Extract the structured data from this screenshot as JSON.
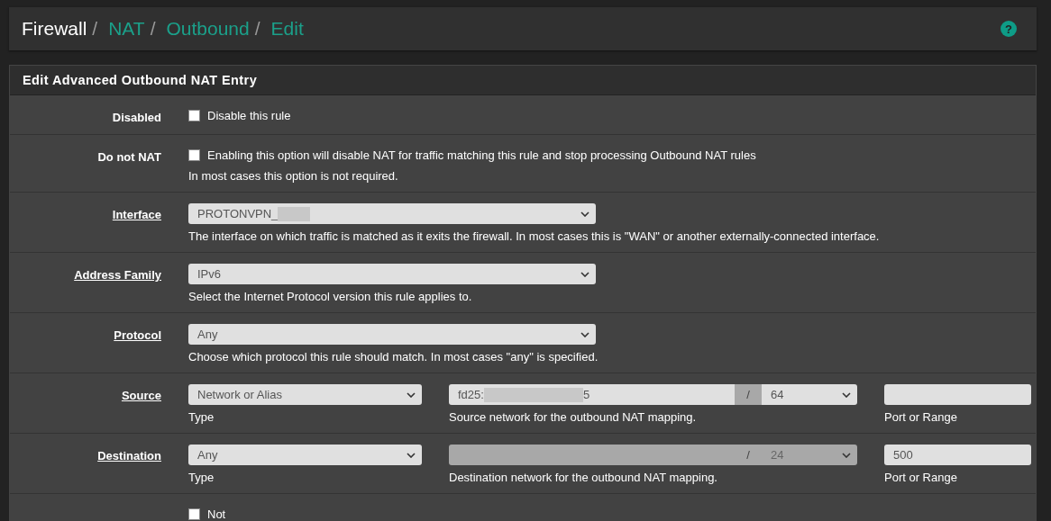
{
  "breadcrumb": [
    {
      "label": "Firewall",
      "link": false
    },
    {
      "label": "NAT",
      "link": true
    },
    {
      "label": "Outbound",
      "link": true
    },
    {
      "label": "Edit",
      "link": true
    }
  ],
  "separator": "/",
  "help": "?",
  "panel": {
    "title": "Edit Advanced Outbound NAT Entry"
  },
  "rows": [
    {
      "kind": "checkbox",
      "label": "Disabled",
      "link": false,
      "checked": false,
      "text": "Disable this rule"
    },
    {
      "kind": "checkbox",
      "label": "Do not NAT",
      "link": false,
      "checked": false,
      "text": "Enabling this option will disable NAT for traffic matching this rule and stop processing Outbound NAT rules",
      "help": "In most cases this option is not required."
    },
    {
      "kind": "select",
      "label": "Interface",
      "link": true,
      "value": "PROTONVPN_",
      "redacted": true,
      "help": "The interface on which traffic is matched as it exits the firewall. In most cases this is \"WAN\" or another externally-connected interface."
    },
    {
      "kind": "select",
      "label": "Address Family",
      "link": true,
      "value": "IPv6",
      "redacted": false,
      "help": "Select the Internet Protocol version this rule applies to."
    },
    {
      "kind": "select",
      "label": "Protocol",
      "link": true,
      "value": "Any",
      "redacted": false,
      "help": "Choose which protocol this rule should match. In most cases \"any\" is specified."
    },
    {
      "kind": "network",
      "label": "Source",
      "link": true,
      "type": "Network or Alias",
      "type_help": "Type",
      "address": {
        "start": "fd25:",
        "end": "5",
        "disabled": false
      },
      "slash": "/",
      "mask": {
        "value": "64",
        "disabled": false
      },
      "address_help": "Source network for the outbound NAT mapping.",
      "port": "",
      "port_help": "Port or Range"
    },
    {
      "kind": "network",
      "label": "Destination",
      "link": true,
      "type": "Any",
      "type_help": "Type",
      "address": {
        "disabled": true
      },
      "slash": "/",
      "mask": {
        "value": "24",
        "disabled": true
      },
      "address_help": "Destination network for the outbound NAT mapping.",
      "port": "500",
      "port_help": "Port or Range"
    },
    {
      "kind": "checkbox",
      "checked": false,
      "text": "Not"
    }
  ]
}
